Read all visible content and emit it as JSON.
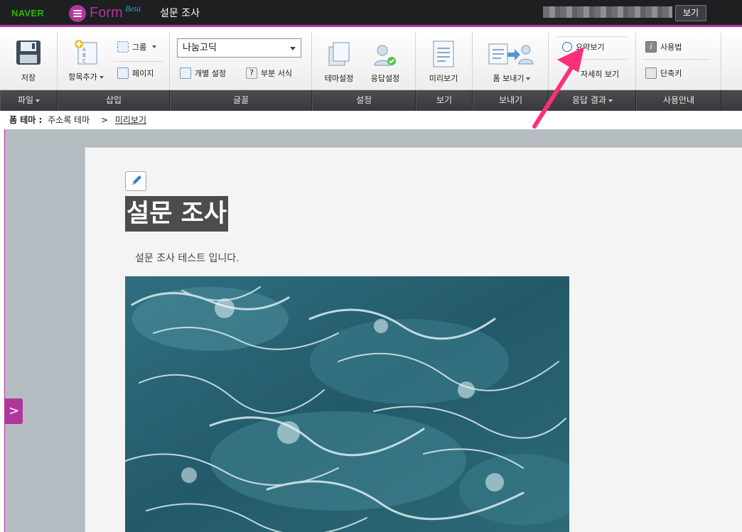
{
  "header": {
    "naver": "NAVER",
    "form_logo_text": "Form",
    "beta": "Beta",
    "doc_title": "설문 조사",
    "view_button": "보기"
  },
  "ribbon": {
    "save": "저장",
    "add_item": "항목추가",
    "group": "그룹",
    "page": "페이지",
    "font_select": "나눔고딕",
    "individual_setting": "개별 설정",
    "partial_format": "부분 서식",
    "theme_setting": "테마설정",
    "response_setting": "응답설정",
    "preview": "미리보기",
    "send_form": "폼 보내기",
    "summary_view": "요약보기",
    "detail_view": "자세히 보기",
    "usage": "사용법",
    "shortcut": "단축키"
  },
  "group_labels": {
    "file": "파일",
    "insert": "삽입",
    "font": "글꼴",
    "settings": "설정",
    "view": "보기",
    "send": "보내기",
    "results": "응답 결과",
    "guide": "사용안내"
  },
  "breadcrumb": {
    "label": "폼 테마 :",
    "theme": "주소록 테마",
    "separator": ">",
    "current": "미리보기"
  },
  "survey": {
    "title": "설문 조사",
    "description": "설문 조사 테스트 입니다."
  },
  "colors": {
    "brand": "#b0369d",
    "naver_green": "#2db400",
    "annotation_arrow": "#ff2d7a"
  }
}
